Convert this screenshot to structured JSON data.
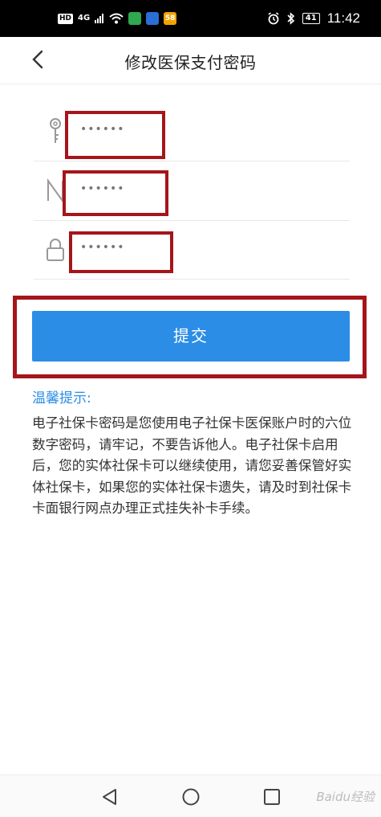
{
  "status_bar": {
    "hd_label": "HD",
    "network_label": "4G",
    "app_badge": "58",
    "battery": "41",
    "time": "11:42"
  },
  "header": {
    "title": "修改医保支付密码"
  },
  "form": {
    "fields": [
      {
        "icon": "key-icon",
        "value": "••••••"
      },
      {
        "icon": "n-letter-icon",
        "value": "••••••"
      },
      {
        "icon": "lock-icon",
        "value": "••••••"
      }
    ],
    "submit_label": "提交"
  },
  "tips": {
    "title": "温馨提示:",
    "body": "电子社保卡密码是您使用电子社保卡医保账户时的六位数字密码，请牢记，不要告诉他人。电子社保卡启用后，您的实体社保卡可以继续使用，请您妥善保管好实体社保卡，如果您的实体社保卡遗失，请及时到社保卡卡面银行网点办理正式挂失补卡手续。"
  },
  "watermark": "Baidu经验",
  "colors": {
    "accent": "#2b8de6",
    "highlight": "#a5151a"
  }
}
